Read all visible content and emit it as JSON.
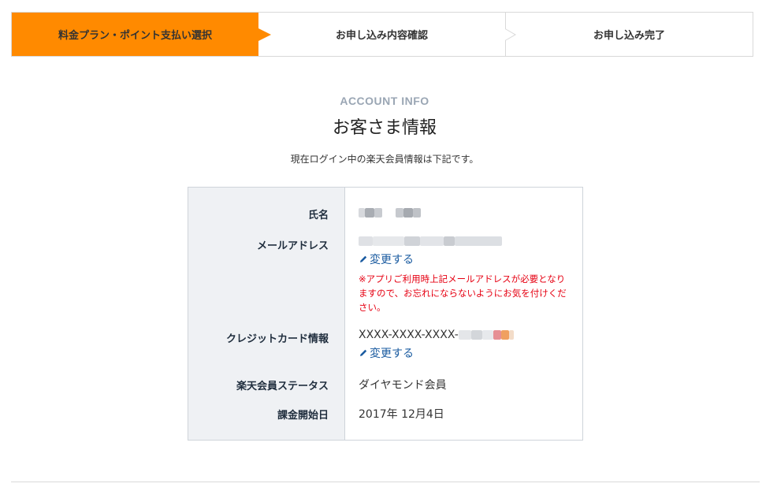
{
  "stepper": {
    "steps": [
      {
        "label": "料金プラン・ポイント支払い選択",
        "active": true
      },
      {
        "label": "お申し込み内容確認",
        "active": false
      },
      {
        "label": "お申し込み完了",
        "active": false
      }
    ]
  },
  "section": {
    "eyebrow": "ACCOUNT INFO",
    "title": "お客さま情報",
    "description": "現在ログイン中の楽天会員情報は下記です。"
  },
  "account": {
    "name_label": "氏名",
    "email_label": "メールアドレス",
    "email_change_link": "変更する",
    "email_notice": "※アプリご利用時上記メールアドレスが必要となりますので、お忘れにならないようにお気を付けください。",
    "card_label": "クレジットカード情報",
    "card_number_prefix": "XXXX-XXXX-XXXX-",
    "card_change_link": "変更する",
    "status_label": "楽天会員ステータス",
    "status_value": "ダイヤモンド会員",
    "billing_label": "課金開始日",
    "billing_value": "2017年 12月4日"
  },
  "colors": {
    "accent": "#ff8a00",
    "link": "#1a5ba0",
    "warning": "#e60012",
    "label_bg": "#eff1f4"
  }
}
